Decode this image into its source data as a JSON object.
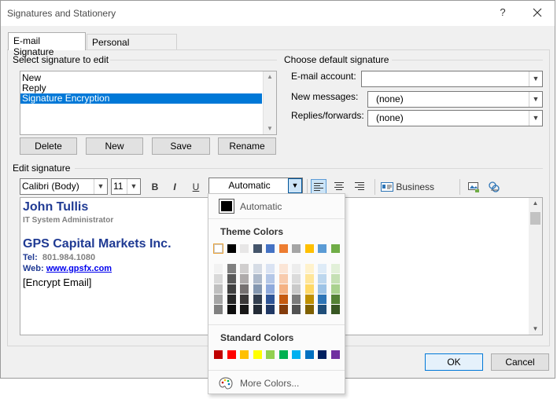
{
  "window": {
    "title": "Signatures and Stationery",
    "help": "?",
    "close": "✕"
  },
  "tabs": [
    {
      "label": "E-mail Signature",
      "active": true
    },
    {
      "label": "Personal Stationery",
      "active": false
    }
  ],
  "select_signature": {
    "label": "Select signature to edit",
    "items": [
      "New",
      "Reply",
      "Signature Encryption"
    ],
    "selected": "Signature Encryption",
    "buttons": {
      "delete": "Delete",
      "new": "New",
      "save": "Save",
      "rename": "Rename"
    }
  },
  "default_signature": {
    "label": "Choose default signature",
    "email_account_label": "E-mail account:",
    "email_account_value": "",
    "new_messages_label": "New messages:",
    "new_messages_value": "(none)",
    "replies_label": "Replies/forwards:",
    "replies_value": "(none)"
  },
  "edit_signature": {
    "label": "Edit signature",
    "font": "Calibri (Body)",
    "size": "11",
    "bold": "B",
    "italic": "I",
    "underline": "U",
    "color": "Automatic",
    "business_card": "Business Card"
  },
  "signature_content": {
    "name": "John Tullis",
    "role": "IT System Administrator",
    "company": "GPS Capital Markets Inc.",
    "tel_label": "Tel:",
    "tel_value": "801.984.1080",
    "web_label": "Web:",
    "web_value": "www.gpsfx.com",
    "encrypt_text": "[Encrypt Email]"
  },
  "footer": {
    "ok": "OK",
    "cancel": "Cancel"
  },
  "color_dropdown": {
    "automatic": "Automatic",
    "theme_colors_label": "Theme Colors",
    "standard_colors_label": "Standard Colors",
    "more_colors": "More Colors...",
    "theme_top": [
      "#ffffff",
      "#000000",
      "#e7e6e6",
      "#44546a",
      "#4472c4",
      "#ed7d31",
      "#a5a5a5",
      "#ffc000",
      "#5b9bd5",
      "#70ad47"
    ],
    "theme_shades": [
      [
        "#f2f2f2",
        "#d9d9d9",
        "#bfbfbf",
        "#a6a6a6",
        "#808080"
      ],
      [
        "#7f7f7f",
        "#595959",
        "#404040",
        "#262626",
        "#0d0d0d"
      ],
      [
        "#d0cece",
        "#aeaaaa",
        "#767171",
        "#3b3838",
        "#181717"
      ],
      [
        "#d6dce5",
        "#adb9ca",
        "#8497b0",
        "#333f50",
        "#222a35"
      ],
      [
        "#dae3f3",
        "#b4c7e7",
        "#8faadc",
        "#2f5597",
        "#203864"
      ],
      [
        "#fbe5d6",
        "#f8cbad",
        "#f4b183",
        "#c55a11",
        "#843c0c"
      ],
      [
        "#ededed",
        "#dbdbdb",
        "#c9c9c9",
        "#7b7b7b",
        "#525252"
      ],
      [
        "#fff2cc",
        "#ffe699",
        "#ffd966",
        "#bf9000",
        "#7f6000"
      ],
      [
        "#deebf7",
        "#bdd7ee",
        "#9dc3e6",
        "#2e75b6",
        "#1f4e79"
      ],
      [
        "#e2f0d9",
        "#c5e0b4",
        "#a9d18e",
        "#548235",
        "#385723"
      ]
    ],
    "standard": [
      "#c00000",
      "#ff0000",
      "#ffc000",
      "#ffff00",
      "#92d050",
      "#00b050",
      "#00b0f0",
      "#0070c0",
      "#002060",
      "#7030a0"
    ]
  }
}
